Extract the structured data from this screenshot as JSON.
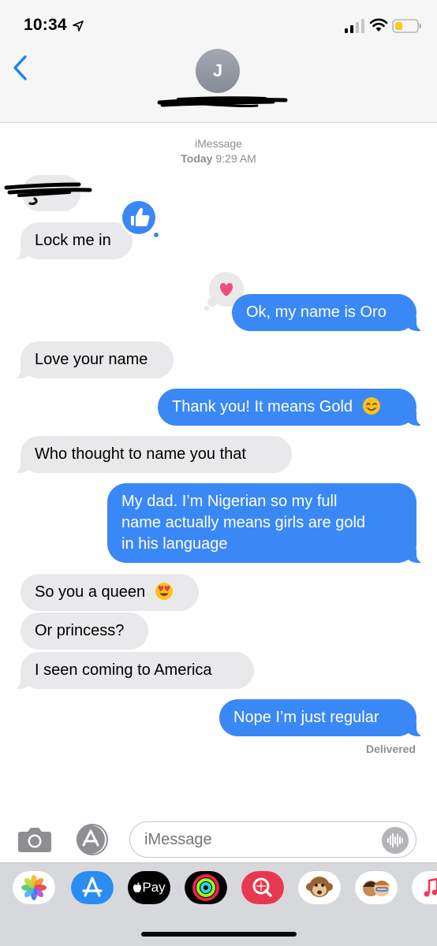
{
  "status_bar": {
    "time": "10:34"
  },
  "header": {
    "avatar_initial": "J"
  },
  "thread_meta": {
    "service": "iMessage",
    "day": "Today",
    "time": "9:29 AM"
  },
  "messages": [
    {
      "side": "in",
      "text": "Lock me in",
      "tapback": "thumbs-up"
    },
    {
      "side": "out",
      "text": "Ok, my name is Oro",
      "tapback": "heart"
    },
    {
      "side": "in",
      "text": "Love your name"
    },
    {
      "side": "out",
      "text": "Thank you! It means Gold",
      "emoji": "smiling-face-emoji"
    },
    {
      "side": "in",
      "text": "Who thought to name you that"
    },
    {
      "side": "out",
      "lines": [
        "My dad. I’m Nigerian so my full",
        "name actually means girls are gold",
        "in his language"
      ]
    },
    {
      "side": "in",
      "text": "So you a queen",
      "emoji": "heart-eyes-emoji"
    },
    {
      "side": "in",
      "text": "Or princess?"
    },
    {
      "side": "in",
      "text": "I seen coming to America"
    },
    {
      "side": "out",
      "text": "Nope I’m just regular"
    }
  ],
  "delivered_label": "Delivered",
  "composer": {
    "placeholder": "iMessage"
  },
  "app_drawer": {
    "apps": [
      "photos-app-icon",
      "app-store-icon",
      "apple-pay-icon",
      "activity-icon",
      "search-images-icon",
      "animoji-monkey-icon",
      "memoji-icon",
      "music-icon"
    ],
    "apple_pay_label": "Pay"
  },
  "colors": {
    "outgoing": "#3a88f5",
    "incoming": "#e9e9eb",
    "tapback": "#3a88f5"
  }
}
